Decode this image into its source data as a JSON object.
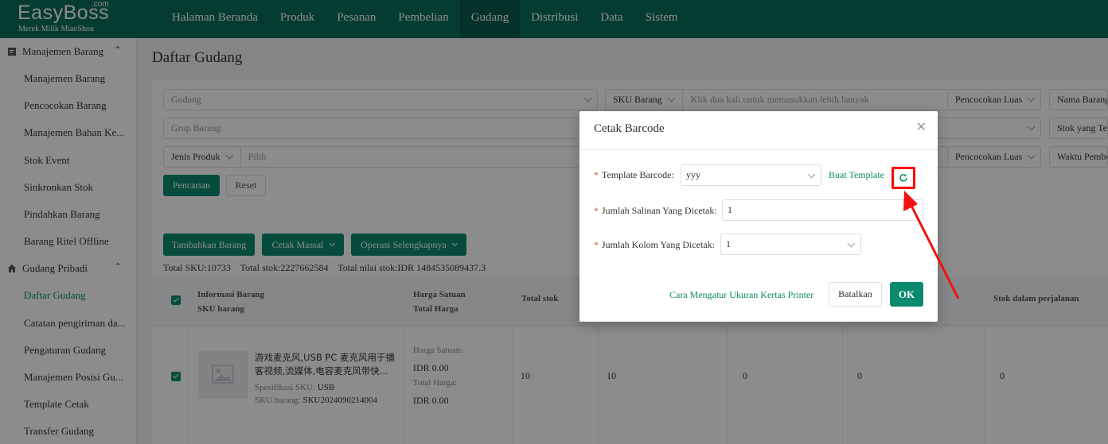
{
  "brand": {
    "name": "EasyBoss",
    "domain_suffix": ".com",
    "tagline": "Merek Milik MiaoShou"
  },
  "topnav": {
    "items": [
      "Halaman Beranda",
      "Produk",
      "Pesanan",
      "Pembelian",
      "Gudang",
      "Distribusi",
      "Data",
      "Sistem"
    ],
    "active": "Gudang"
  },
  "sidebar": {
    "group1": {
      "label": "Manajemen Barang",
      "icon": "clipboard-icon"
    },
    "group1_items": [
      "Manajemen Barang",
      "Pencocokan Barang",
      "Manajemen Bahan Ke...",
      "Stok Event",
      "Sinkronkan Stok",
      "Pindahkan Barang",
      "Barang Ritel Offline"
    ],
    "group2": {
      "label": "Gudang Pribadi",
      "icon": "home-icon"
    },
    "group2_items": [
      "Daftar Gudang",
      "Catatan pengiriman da...",
      "Pengaturan Gudang",
      "Manajemen Posisi Gu...",
      "Template Cetak",
      "Transfer Gudang"
    ]
  },
  "page": {
    "title": "Daftar Gudang"
  },
  "filters": {
    "warehouse_placeholder": "Gudang",
    "sku_select": "SKU Barang",
    "sku_placeholder": "Klik dua kali untuk memasukkan lebih banyak",
    "match_mode": "Pencocokan Luas",
    "name_select": "Nama Barang",
    "group_placeholder": "Grup Barang",
    "stock_select": "Stok yang Ter",
    "product_type_select": "Jenis Produk",
    "product_type_placeholder": "Pilih",
    "match_mode2": "Pencocokan Luas",
    "time_select": "Waktu Pembu",
    "search_button": "Pencarian",
    "reset_button": "Reset"
  },
  "toolbar": {
    "add_button": "Tambahkan Barang",
    "batch_print_button": "Cetak Massal",
    "more_button": "Operasi Selengkapnya"
  },
  "totals": {
    "sku": "Total SKU:10733",
    "stock": "Total stok:2227662584",
    "value_label": "Total nilai stok:",
    "value": "IDR 1484535089437.3"
  },
  "table": {
    "headers": {
      "info": "Informasi Barang",
      "sku": "SKU barang",
      "unit_price": "Harga Satuan",
      "total_price": "Total Harga",
      "total_stock": "Total stok",
      "transit_stock": "Stok dalam perjalanan"
    },
    "row": {
      "name_line1": "游戏麦克风,USB PC 麦克风用于播",
      "name_line2": "客视频,流媒体,电容麦克风带快...",
      "spec_label": "Spesifikasi SKU:",
      "spec_value": "USB",
      "sku_label": "SKU barang:",
      "sku_value": "SKU2024090214004",
      "unit_price_label": "Harga Satuan:",
      "unit_price_value": "IDR 0.00",
      "total_price_label": "Total Harga:",
      "total_price_value": "IDR 0.00",
      "col_a": "10",
      "col_b": "10",
      "col_c": "0",
      "col_d": "0",
      "col_e": "0"
    }
  },
  "modal": {
    "title": "Cetak Barcode",
    "template_label": "Template Barcode:",
    "template_value": "yyy",
    "create_template_link": "Buat Template",
    "copies_label": "Jumlah Salinan Yang Dicetak:",
    "copies_value": "1",
    "columns_label": "Jumlah Kolom Yang Dicetak:",
    "columns_value": "1",
    "paper_size_link": "Cara Mengatur Ukuran Kertas Printer",
    "cancel_button": "Batalkan",
    "ok_button": "OK"
  },
  "colors": {
    "brand": "#0a6e5c",
    "accent": "#0a8a6f",
    "highlight": "#ff0000"
  }
}
